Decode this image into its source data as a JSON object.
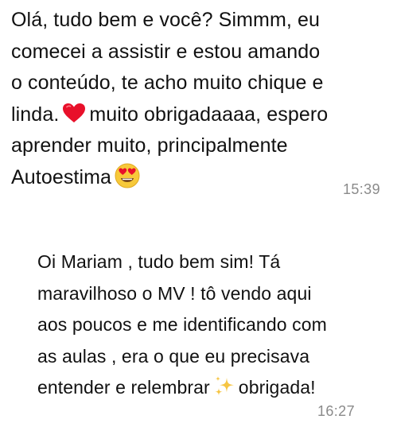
{
  "messages": [
    {
      "lines": [
        "Olá, tudo bem e você? Simmm, eu",
        "comecei a assistir e estou amando",
        "o conteúdo, te acho muito chique e",
        {
          "before": "linda.",
          "icon": "red-heart-icon",
          "after": "muito obrigadaaaa, espero"
        },
        "aprender muito, principalmente",
        {
          "before": "Autoestima",
          "icon": "heart-eyes-icon",
          "after": ""
        }
      ],
      "time": "15:39"
    },
    {
      "lines": [
        "Oi Mariam , tudo bem sim! Tá",
        "maravilhoso o MV ! tô vendo aqui",
        "aos poucos e me identificando com",
        "as aulas , era o que eu precisava",
        {
          "before": "entender e relembrar",
          "icon": "sparkles-icon",
          "after": "obrigada!"
        }
      ],
      "time": "16:27"
    }
  ],
  "icons": {
    "red-heart-icon": {
      "color": "#e8102a"
    },
    "heart-eyes-icon": {
      "face": "#f7c93a",
      "eyes": "#e8102a"
    },
    "sparkles-icon": {
      "color": "#f6c543"
    }
  }
}
